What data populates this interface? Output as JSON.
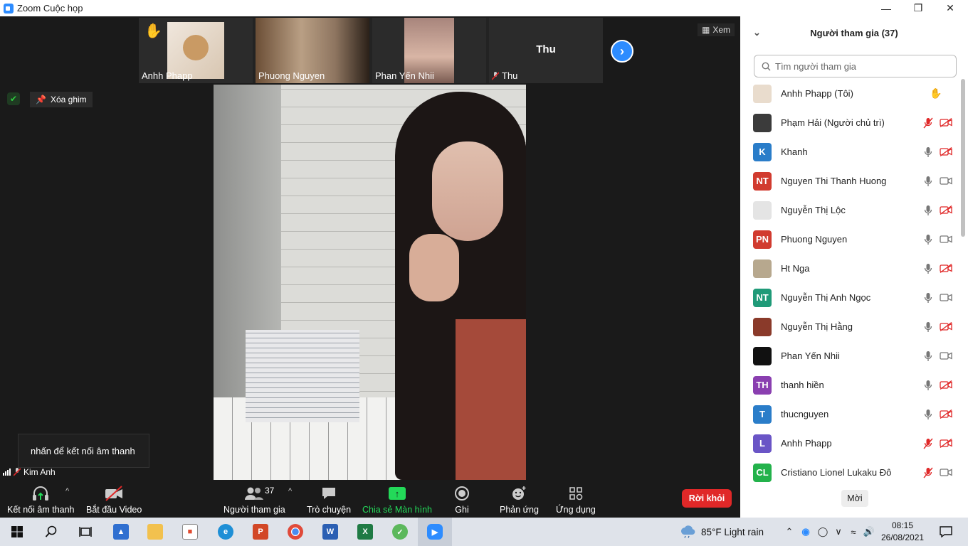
{
  "window": {
    "title": "Zoom Cuộc họp"
  },
  "thumbnails": [
    {
      "name": "Anhh Phapp",
      "hand": "✋"
    },
    {
      "name": "Phuong Nguyen"
    },
    {
      "name": "Phan Yến Nhii"
    },
    {
      "name": "Thu",
      "big_label": "Thu"
    }
  ],
  "view_label": "Xem",
  "unpin_label": "Xóa ghim",
  "audio_tooltip": "nhấn để kết nối âm thanh",
  "self_name": "Kim Anh",
  "toolbar": {
    "audio": "Kết nối âm thanh",
    "video": "Bắt đầu Video",
    "participants": "Người tham gia",
    "participants_count": "37",
    "chat": "Trò chuyện",
    "share": "Chia sẻ Màn hình",
    "record": "Ghi",
    "reactions": "Phản ứng",
    "apps": "Ứng dụng",
    "leave": "Rời khỏi"
  },
  "panel": {
    "title": "Người tham gia (37)",
    "search_placeholder": "Tìm người tham gia",
    "invite": "Mời",
    "participants": [
      {
        "name": "Anhh Phapp (Tôi)",
        "avatar": "",
        "avatar_color": "#e9dccd",
        "mic": "hand",
        "cam": "none"
      },
      {
        "name": "Phạm Hải (Người chủ trì)",
        "avatar": "",
        "avatar_color": "#3b3b3b",
        "mic": "muted",
        "cam": "off"
      },
      {
        "name": "Khanh",
        "avatar": "K",
        "avatar_color": "#2a7dc9",
        "mic": "on",
        "cam": "off"
      },
      {
        "name": "Nguyen Thi Thanh Huong",
        "avatar": "NT",
        "avatar_color": "#d13b2f",
        "mic": "on",
        "cam": "on"
      },
      {
        "name": "Nguyễn Thị Lộc",
        "avatar": "",
        "avatar_color": "#e4e4e4",
        "mic": "on",
        "cam": "off"
      },
      {
        "name": "Phuong Nguyen",
        "avatar": "PN",
        "avatar_color": "#d13b2f",
        "mic": "on",
        "cam": "on"
      },
      {
        "name": "Ht Nga",
        "avatar": "",
        "avatar_color": "#b7a88e",
        "mic": "on",
        "cam": "off"
      },
      {
        "name": "Nguyễn Thị Anh Ngọc",
        "avatar": "NT",
        "avatar_color": "#1f9a78",
        "mic": "on",
        "cam": "on"
      },
      {
        "name": "Nguyễn Thị Hằng",
        "avatar": "",
        "avatar_color": "#8a3a2a",
        "mic": "on",
        "cam": "off"
      },
      {
        "name": "Phan Yến Nhii",
        "avatar": "",
        "avatar_color": "#111111",
        "mic": "on",
        "cam": "on"
      },
      {
        "name": "thanh hiền",
        "avatar": "TH",
        "avatar_color": "#8a3fb0",
        "mic": "on",
        "cam": "off"
      },
      {
        "name": "thucnguyen",
        "avatar": "T",
        "avatar_color": "#2a7dc9",
        "mic": "on",
        "cam": "off"
      },
      {
        "name": "Anhh Phapp",
        "avatar": "L",
        "avatar_color": "#6a55c6",
        "mic": "muted",
        "cam": "off"
      },
      {
        "name": "Cristiano Lionel Lukaku Đô",
        "avatar": "CL",
        "avatar_color": "#23b24b",
        "mic": "muted",
        "cam": "on"
      }
    ]
  },
  "taskbar": {
    "weather": "85°F  Light rain",
    "time": "08:15",
    "date": "26/08/2021"
  },
  "colors": {
    "accent": "#2d8cff",
    "leave": "#e02828",
    "share": "#23d959",
    "muted": "#e02828"
  }
}
